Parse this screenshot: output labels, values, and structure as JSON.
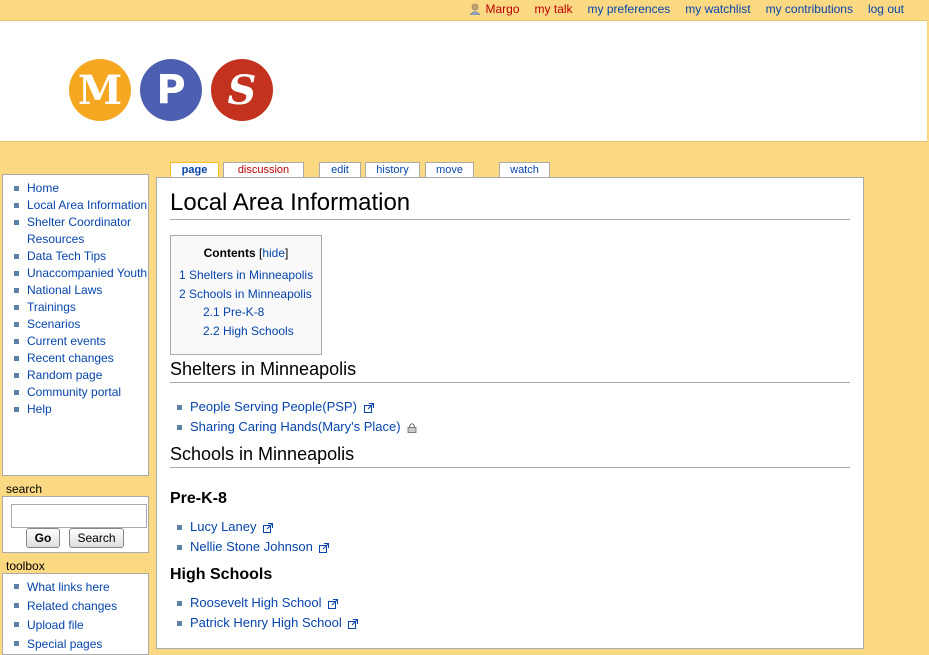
{
  "personal": {
    "user": "Margo",
    "items": [
      "my talk",
      "my preferences",
      "my watchlist",
      "my contributions",
      "log out"
    ]
  },
  "logo": {
    "letters": [
      "M",
      "P",
      "S"
    ],
    "colors": [
      "#f5a722",
      "#4d5fb0",
      "#c3321f"
    ]
  },
  "tabs": [
    "page",
    "discussion",
    "edit",
    "history",
    "move",
    "watch"
  ],
  "page": {
    "title": "Local Area Information",
    "toc": {
      "title": "Contents",
      "hide": "hide",
      "items": [
        "1 Shelters in Minneapolis",
        "2 Schools in Minneapolis",
        "2.1 Pre-K-8",
        "2.2 High Schools"
      ]
    },
    "sections": {
      "shelters": {
        "heading": "Shelters in Minneapolis",
        "links": [
          "People Serving People(PSP)",
          "Sharing Caring Hands(Mary's Place)"
        ]
      },
      "schools": {
        "heading": "Schools in Minneapolis",
        "prek": {
          "heading": "Pre-K-8",
          "links": [
            "Lucy Laney",
            "Nellie Stone Johnson"
          ]
        },
        "high": {
          "heading": "High Schools",
          "links": [
            "Roosevelt High School",
            "Patrick Henry High School"
          ]
        }
      }
    }
  },
  "navigation": {
    "items": [
      "Home",
      "Local Area Information",
      "Shelter Coordinator Resources",
      "Data Tech Tips",
      "Unaccompanied Youth",
      "National Laws",
      "Trainings",
      "Scenarios",
      "Current events",
      "Recent changes",
      "Random page",
      "Community portal",
      "Help"
    ]
  },
  "search": {
    "title": "search",
    "go": "Go",
    "search": "Search"
  },
  "toolbox": {
    "title": "toolbox",
    "items": [
      "What links here",
      "Related changes",
      "Upload file",
      "Special pages"
    ]
  }
}
